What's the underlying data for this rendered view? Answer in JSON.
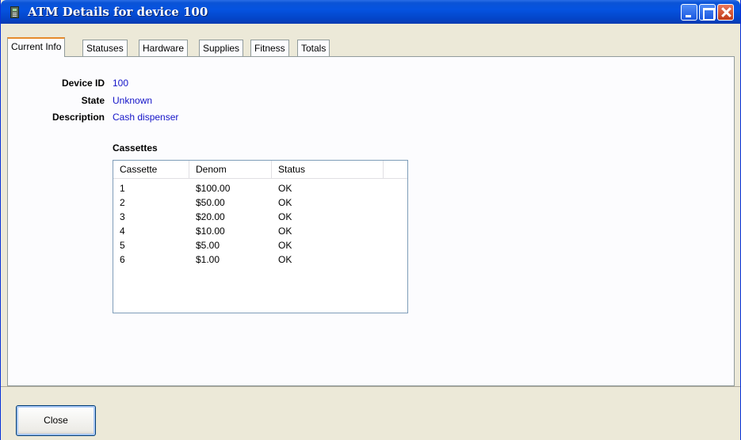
{
  "window": {
    "title": "ATM Details for device 100"
  },
  "tabs": [
    {
      "label": "Current Info"
    },
    {
      "label": "Statuses"
    },
    {
      "label": "Hardware"
    },
    {
      "label": "Supplies"
    },
    {
      "label": "Fitness"
    },
    {
      "label": "Totals"
    }
  ],
  "details": {
    "device_id_label": "Device ID",
    "device_id_value": "100",
    "state_label": "State",
    "state_value": "Unknown",
    "description_label": "Description",
    "description_value": "Cash dispenser"
  },
  "cassettes": {
    "title": "Cassettes",
    "columns": [
      "Cassette",
      "Denom",
      "Status",
      ""
    ],
    "rows": [
      {
        "cassette": "1",
        "denom": "$100.00",
        "status": "OK"
      },
      {
        "cassette": "2",
        "denom": "$50.00",
        "status": "OK"
      },
      {
        "cassette": "3",
        "denom": "$20.00",
        "status": "OK"
      },
      {
        "cassette": "4",
        "denom": "$10.00",
        "status": "OK"
      },
      {
        "cassette": "5",
        "denom": "$5.00",
        "status": "OK"
      },
      {
        "cassette": "6",
        "denom": "$1.00",
        "status": "OK"
      }
    ]
  },
  "footer": {
    "close_label": "Close"
  },
  "colors": {
    "title_bar": "#0553e0",
    "value_text": "#1414c8",
    "active_tab_accent": "#e68b2c"
  },
  "icons": {
    "app": "atm-icon",
    "minimize": "minimize-icon",
    "maximize": "maximize-icon",
    "close": "close-icon"
  }
}
